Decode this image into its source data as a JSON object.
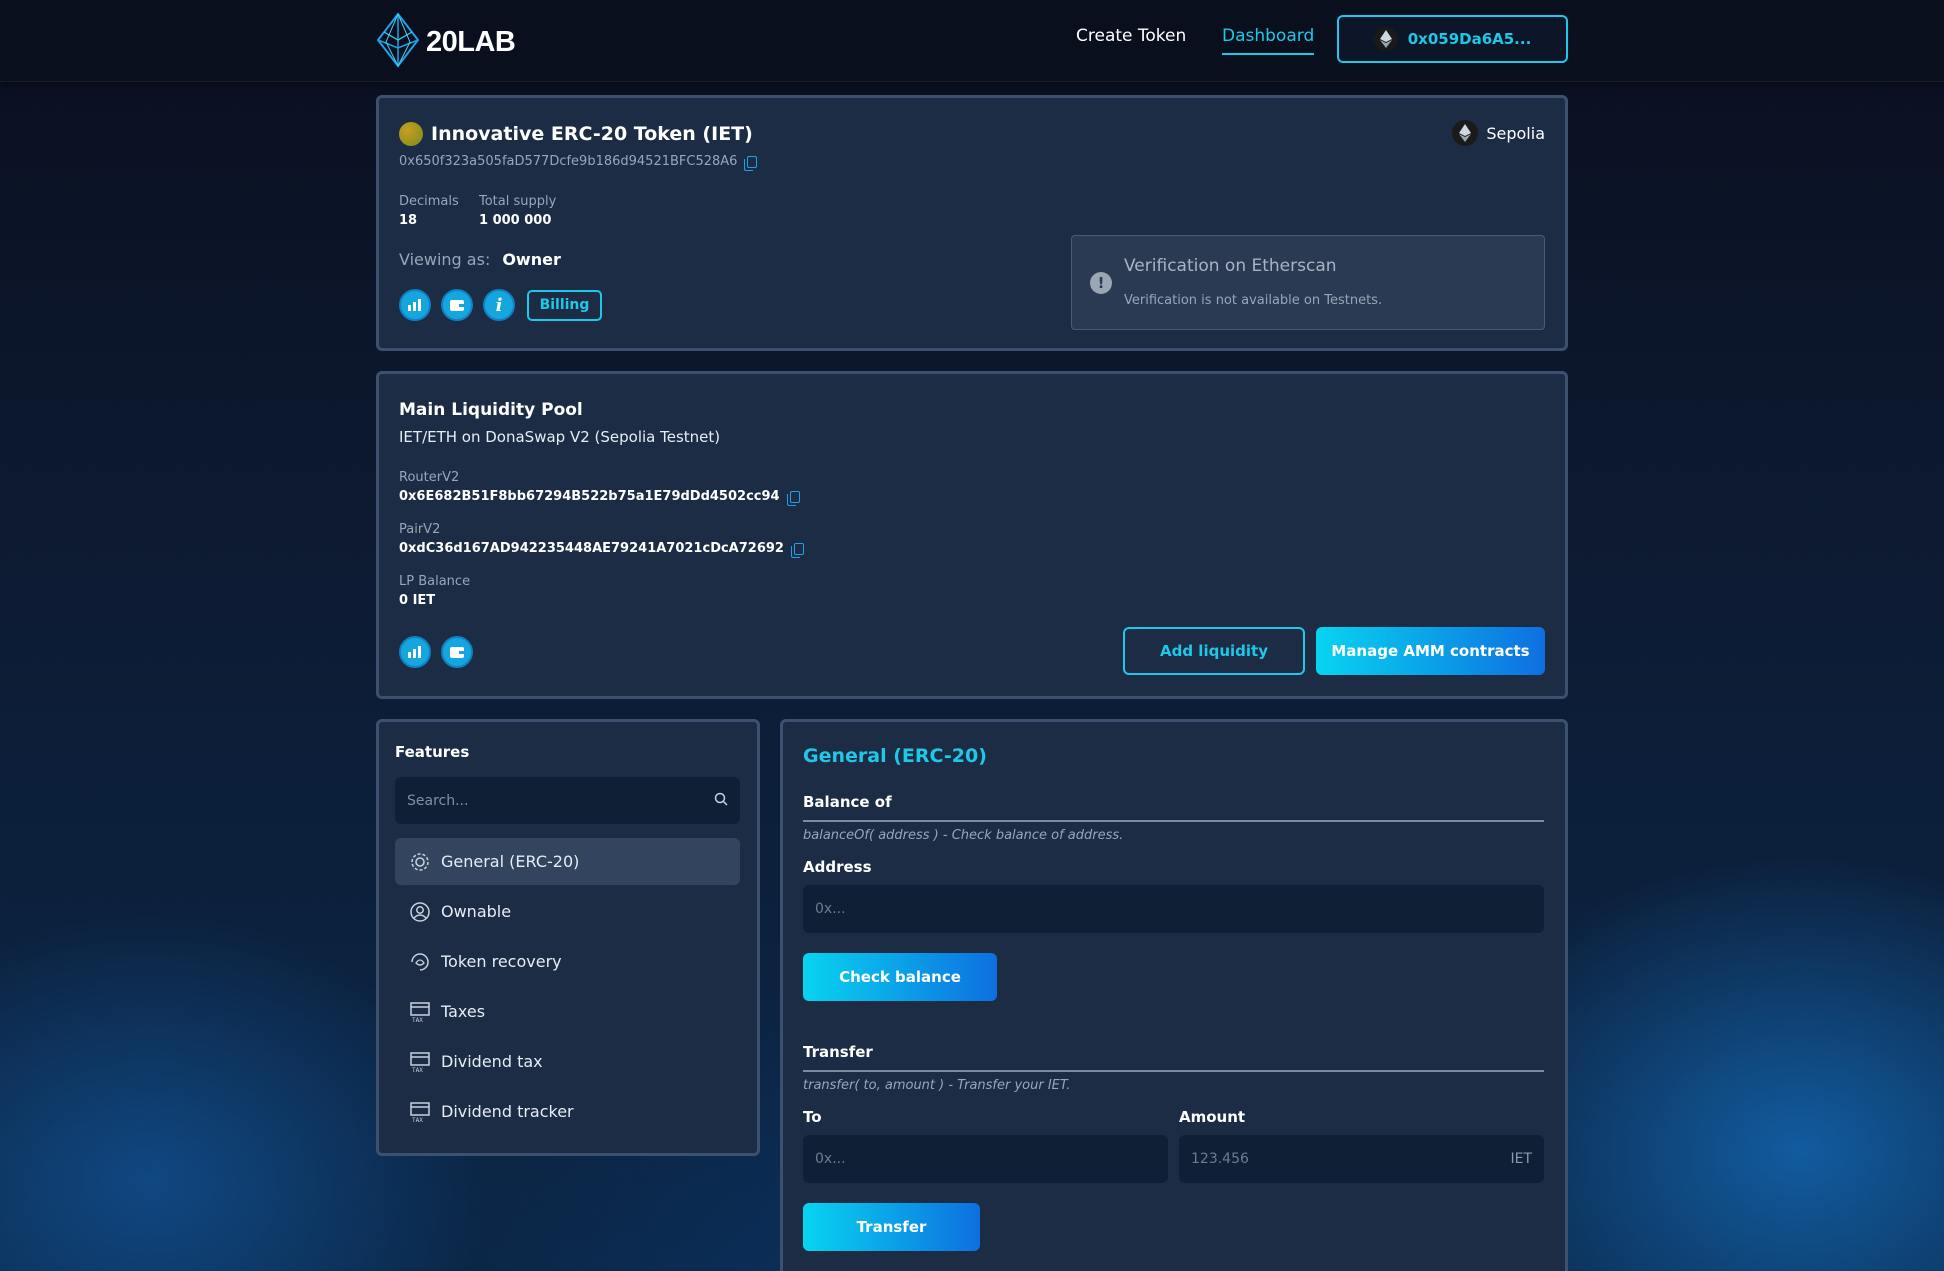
{
  "header": {
    "logo_text": "20LAB",
    "nav": {
      "create_token": "Create Token",
      "dashboard": "Dashboard"
    },
    "wallet_address": "0x059Da6A5..."
  },
  "token": {
    "name": "Innovative ERC-20 Token (IET)",
    "address": "0x650f323a505faD577Dcfe9b186d94521BFC528A6",
    "network": "Sepolia",
    "decimals_label": "Decimals",
    "decimals_value": "18",
    "supply_label": "Total supply",
    "supply_value": "1 000 000",
    "viewing_as_label": "Viewing as:",
    "viewing_as_value": "Owner",
    "billing_label": "Billing",
    "verification": {
      "title": "Verification on Etherscan",
      "text": "Verification is not available on Testnets."
    }
  },
  "pool": {
    "title": "Main Liquidity Pool",
    "subtitle": "IET/ETH on DonaSwap V2 (Sepolia Testnet)",
    "router_label": "RouterV2",
    "router_value": "0x6E682B51F8bb67294B522b75a1E79dDd4502cc94",
    "pair_label": "PairV2",
    "pair_value": "0xdC36d167AD942235448AE79241A7021cDcA72692",
    "lp_label": "LP Balance",
    "lp_value": "0 IET",
    "add_liquidity": "Add liquidity",
    "manage_amm": "Manage AMM contracts"
  },
  "features": {
    "title": "Features",
    "search_placeholder": "Search...",
    "items": [
      {
        "label": "General (ERC-20)",
        "icon": "gear-icon"
      },
      {
        "label": "Ownable",
        "icon": "user-circle-icon"
      },
      {
        "label": "Token recovery",
        "icon": "recovery-icon"
      },
      {
        "label": "Taxes",
        "icon": "tax-icon"
      },
      {
        "label": "Dividend tax",
        "icon": "tax-icon"
      },
      {
        "label": "Dividend tracker",
        "icon": "tax-icon"
      }
    ]
  },
  "general": {
    "title": "General (ERC-20)",
    "balance": {
      "title": "Balance of",
      "desc": "balanceOf( address ) - Check balance of address.",
      "address_label": "Address",
      "address_placeholder": "0x...",
      "button": "Check balance"
    },
    "transfer": {
      "title": "Transfer",
      "desc": "transfer( to, amount ) - Transfer your IET.",
      "to_label": "To",
      "to_placeholder": "0x...",
      "amount_label": "Amount",
      "amount_placeholder": "123.456",
      "amount_unit": "IET",
      "button": "Transfer"
    }
  },
  "colors": {
    "accent": "#1fc8e8",
    "card": "#1c2c45",
    "border": "#3c5170"
  }
}
